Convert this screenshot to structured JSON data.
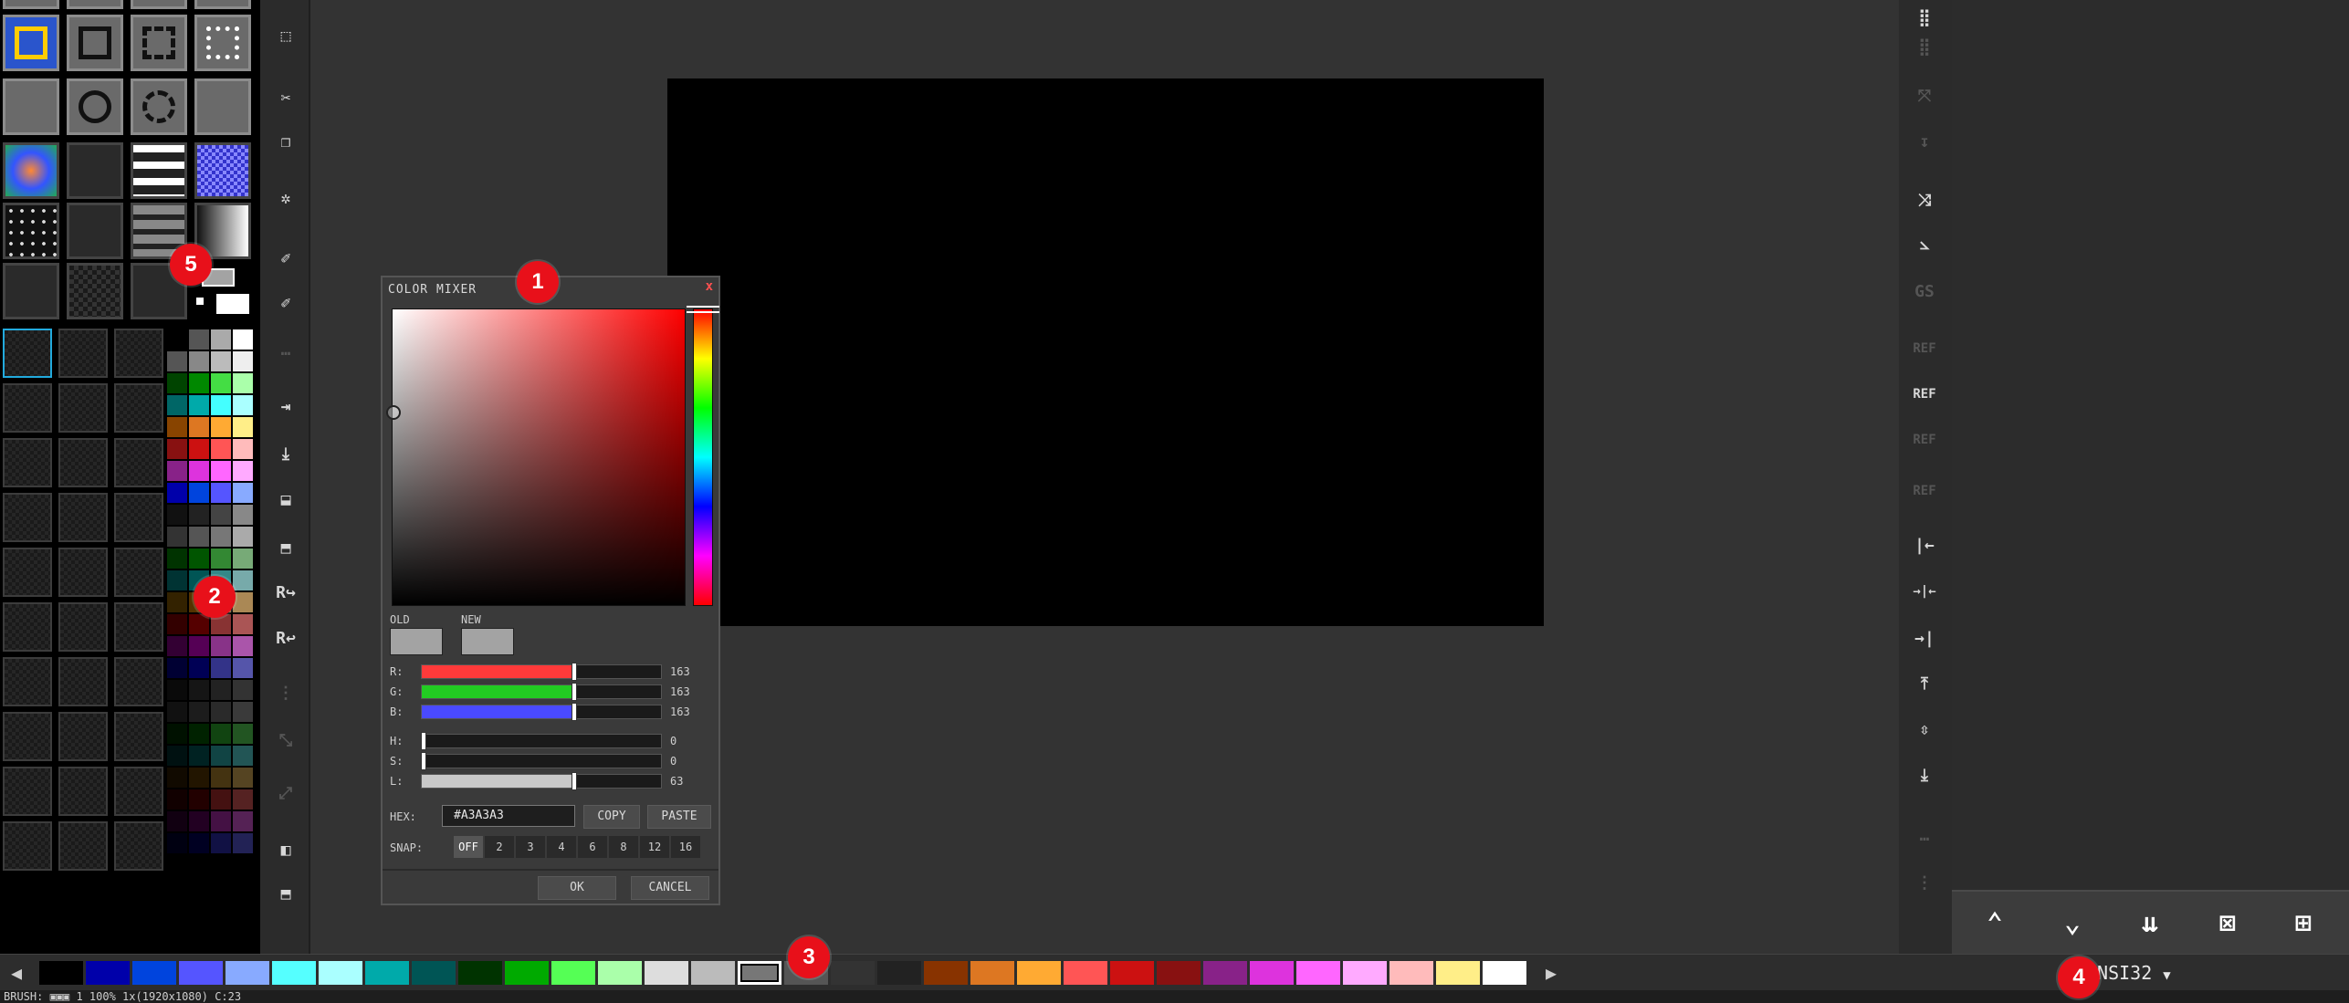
{
  "mixer": {
    "title": "COLOR MIXER",
    "close_glyph": "x",
    "old_label": "OLD",
    "new_label": "NEW",
    "old_color": "#A3A3A3",
    "new_color": "#A3A3A3",
    "rgb": [
      {
        "label": "R:",
        "value": "163",
        "fraction": 0.639,
        "color": "#ff3a3a"
      },
      {
        "label": "G:",
        "value": "163",
        "fraction": 0.639,
        "color": "#22cc22"
      },
      {
        "label": "B:",
        "value": "163",
        "fraction": 0.639,
        "color": "#4a4aff"
      }
    ],
    "hsl": [
      {
        "label": "H:",
        "value": "0",
        "fraction": 0.0
      },
      {
        "label": "S:",
        "value": "0",
        "fraction": 0.0
      },
      {
        "label": "L:",
        "value": "63",
        "fraction": 0.63
      }
    ],
    "hex_label": "HEX:",
    "hex_value": "#A3A3A3",
    "copy_label": "COPY",
    "paste_label": "PASTE",
    "snap_label": "SNAP:",
    "snap_options": [
      "OFF",
      "2",
      "3",
      "4",
      "6",
      "8",
      "12",
      "16"
    ],
    "snap_selected": "OFF",
    "ok_label": "OK",
    "cancel_label": "CANCEL",
    "hue_color": "#ff0000"
  },
  "tool_strip_left": [
    "⬚",
    "✂",
    "❐",
    "✲",
    "✐",
    "✐",
    "⋯",
    "⇥",
    "⤓",
    "⬓",
    "⬒",
    "R↪",
    "R↩",
    "⋮",
    "⤡",
    "⤢",
    "◧",
    "⬒"
  ],
  "tool_strip_right": [
    "⣿",
    "⣿",
    "⤧",
    "↧",
    "⤨",
    "⦣",
    "GS",
    "REF",
    "REF",
    "REF",
    "REF",
    "|←",
    "→|←",
    "→|",
    "⤒",
    "⇳",
    "⤓",
    "⋯",
    "⋮"
  ],
  "right_panel_buttons": [
    "⌃",
    "⌄",
    "⇊",
    "⊠",
    "⊞"
  ],
  "bottom_palette": {
    "left_arrow": "◀",
    "right_arrow": "▶",
    "colors": [
      "#000000",
      "#0000aa",
      "#0044dd",
      "#5555ff",
      "#88aaff",
      "#55ffff",
      "#aaffff",
      "#00aaaa",
      "#005555",
      "#003300",
      "#00aa00",
      "#55ff55",
      "#aaffaa",
      "#dddddd",
      "#bbbbbb",
      "#777777",
      "#555555",
      "#333333",
      "#222222",
      "#883300",
      "#dd7722",
      "#ffaa33",
      "#ff5555",
      "#cc1111",
      "#881111",
      "#882288",
      "#dd33dd",
      "#ff66ff",
      "#ffaaff",
      "#ffbbbb",
      "#ffee88",
      "#ffffff"
    ],
    "selected_index": 15,
    "name": "ANSI32",
    "dropdown_glyph": "▼"
  },
  "status": {
    "text": "BRUSH: ▣▣▣   1 100% 1x(1920x1080) C:23"
  },
  "callouts": [
    "1",
    "2",
    "3",
    "4",
    "5"
  ],
  "left_palette": {
    "colors": [
      [
        "#000000",
        "#555555",
        "#aaaaaa",
        "#ffffff"
      ],
      [
        "#555555",
        "#888888",
        "#bbbbbb",
        "#eeeeee"
      ],
      [
        "#004400",
        "#008800",
        "#44dd44",
        "#aaffaa"
      ],
      [
        "#006666",
        "#00aaaa",
        "#44ffff",
        "#aaffff"
      ],
      [
        "#884400",
        "#dd7722",
        "#ffaa33",
        "#ffee88"
      ],
      [
        "#881111",
        "#cc1111",
        "#ff5555",
        "#ffbbbb"
      ],
      [
        "#882288",
        "#dd33dd",
        "#ff66ff",
        "#ffaaff"
      ],
      [
        "#0000aa",
        "#0044dd",
        "#5555ff",
        "#88aaff"
      ],
      [
        "#111111",
        "#222222",
        "#444444",
        "#888888"
      ],
      [
        "#333333",
        "#555555",
        "#777777",
        "#aaaaaa"
      ],
      [
        "#003300",
        "#005500",
        "#338833",
        "#77aa77"
      ],
      [
        "#003333",
        "#005555",
        "#338888",
        "#77aaaa"
      ],
      [
        "#332200",
        "#553300",
        "#886633",
        "#aa8855"
      ],
      [
        "#330000",
        "#550000",
        "#883333",
        "#aa5555"
      ],
      [
        "#330033",
        "#550055",
        "#883388",
        "#aa55aa"
      ],
      [
        "#000033",
        "#000055",
        "#333388",
        "#5555aa"
      ],
      [
        "#0a0a0a",
        "#151515",
        "#222222",
        "#333333"
      ],
      [
        "#111111",
        "#1c1c1c",
        "#2a2a2a",
        "#3a3a3a"
      ],
      [
        "#001100",
        "#002200",
        "#114411",
        "#225522"
      ],
      [
        "#001111",
        "#002222",
        "#114444",
        "#225555"
      ],
      [
        "#110a00",
        "#221500",
        "#443311",
        "#554422"
      ],
      [
        "#110000",
        "#220000",
        "#441111",
        "#552222"
      ],
      [
        "#110011",
        "#220022",
        "#441144",
        "#552255"
      ],
      [
        "#000011",
        "#000022",
        "#111144",
        "#222255"
      ]
    ]
  }
}
